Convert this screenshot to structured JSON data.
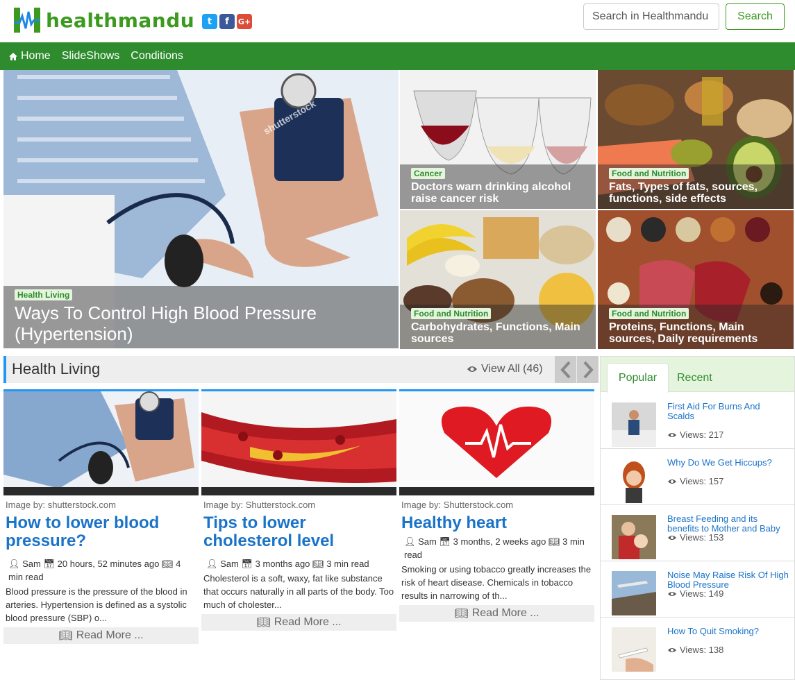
{
  "brand": {
    "name": "healthmandu"
  },
  "social": {
    "twitter": "t",
    "facebook": "f",
    "googleplus": "G+"
  },
  "search": {
    "placeholder": "Search in Healthmandu",
    "button": "Search"
  },
  "nav": {
    "items": [
      {
        "label": "Home",
        "icon": "home-icon"
      },
      {
        "label": "SlideShows"
      },
      {
        "label": "Conditions"
      }
    ]
  },
  "featured": {
    "main": {
      "tag": "Health Living",
      "title": "Ways To Control High Blood Pressure (Hypertension)"
    },
    "tiles": [
      {
        "tag": "Cancer",
        "title": "Doctors warn drinking alcohol raise cancer risk"
      },
      {
        "tag": "Food and Nutrition",
        "title": "Fats, Types of fats, sources, functions, side effects"
      },
      {
        "tag": "Food and Nutrition",
        "title": "Carbohydrates, Functions, Main sources"
      },
      {
        "tag": "Food and Nutrition",
        "title": "Proteins, Functions, Main sources, Daily requirements"
      }
    ],
    "watermark": "shutterstock"
  },
  "section": {
    "title": "Health Living",
    "view_all": "View All (46)"
  },
  "articles": [
    {
      "credit": "Image by: shutterstock.com",
      "title": "How to lower blood pressure?",
      "author": "Sam",
      "time": "20 hours, 52 minutes ago",
      "read": "4 min read",
      "excerpt": "Blood pressure is the pressure of the blood in arteries. Hypertension is defined as a systolic blood pressure (SBP) o...",
      "read_more": "Read More ..."
    },
    {
      "credit": "Image by: Shutterstock.com",
      "title": "Tips to lower cholesterol level",
      "author": "Sam",
      "time": "3 months ago",
      "read": "3 min read",
      "excerpt": "Cholesterol is a soft, waxy, fat like substance that occurs naturally in all parts of the body. Too much of cholester...",
      "read_more": "Read More ..."
    },
    {
      "credit": "Image by: Shutterstock.com",
      "title": "Healthy heart",
      "author": "Sam",
      "time": "3 months, 2 weeks ago",
      "read": "3 min read",
      "excerpt": "Smoking or using tobacco greatly increases the risk of heart disease. Chemicals in tobacco results in narrowing of th...",
      "read_more": "Read More ..."
    }
  ],
  "sidebar": {
    "tabs": [
      "Popular",
      "Recent"
    ],
    "items": [
      {
        "title": "First Aid For Burns And Scalds",
        "views": "Views: 217"
      },
      {
        "title": "Why Do We Get Hiccups?",
        "views": "Views: 157"
      },
      {
        "title": "Breast Feeding and its benefits to Mother and Baby",
        "views": "Views: 153"
      },
      {
        "title": "Noise May Raise Risk Of High Blood Pressure",
        "views": "Views: 149"
      },
      {
        "title": "How To Quit Smoking?",
        "views": "Views: 138"
      }
    ]
  },
  "colors": {
    "brand_green": "#2e8b2e",
    "link_blue": "#1a73c9",
    "accent_blue": "#2196f3",
    "tag_bg": "#e5f5dd"
  }
}
